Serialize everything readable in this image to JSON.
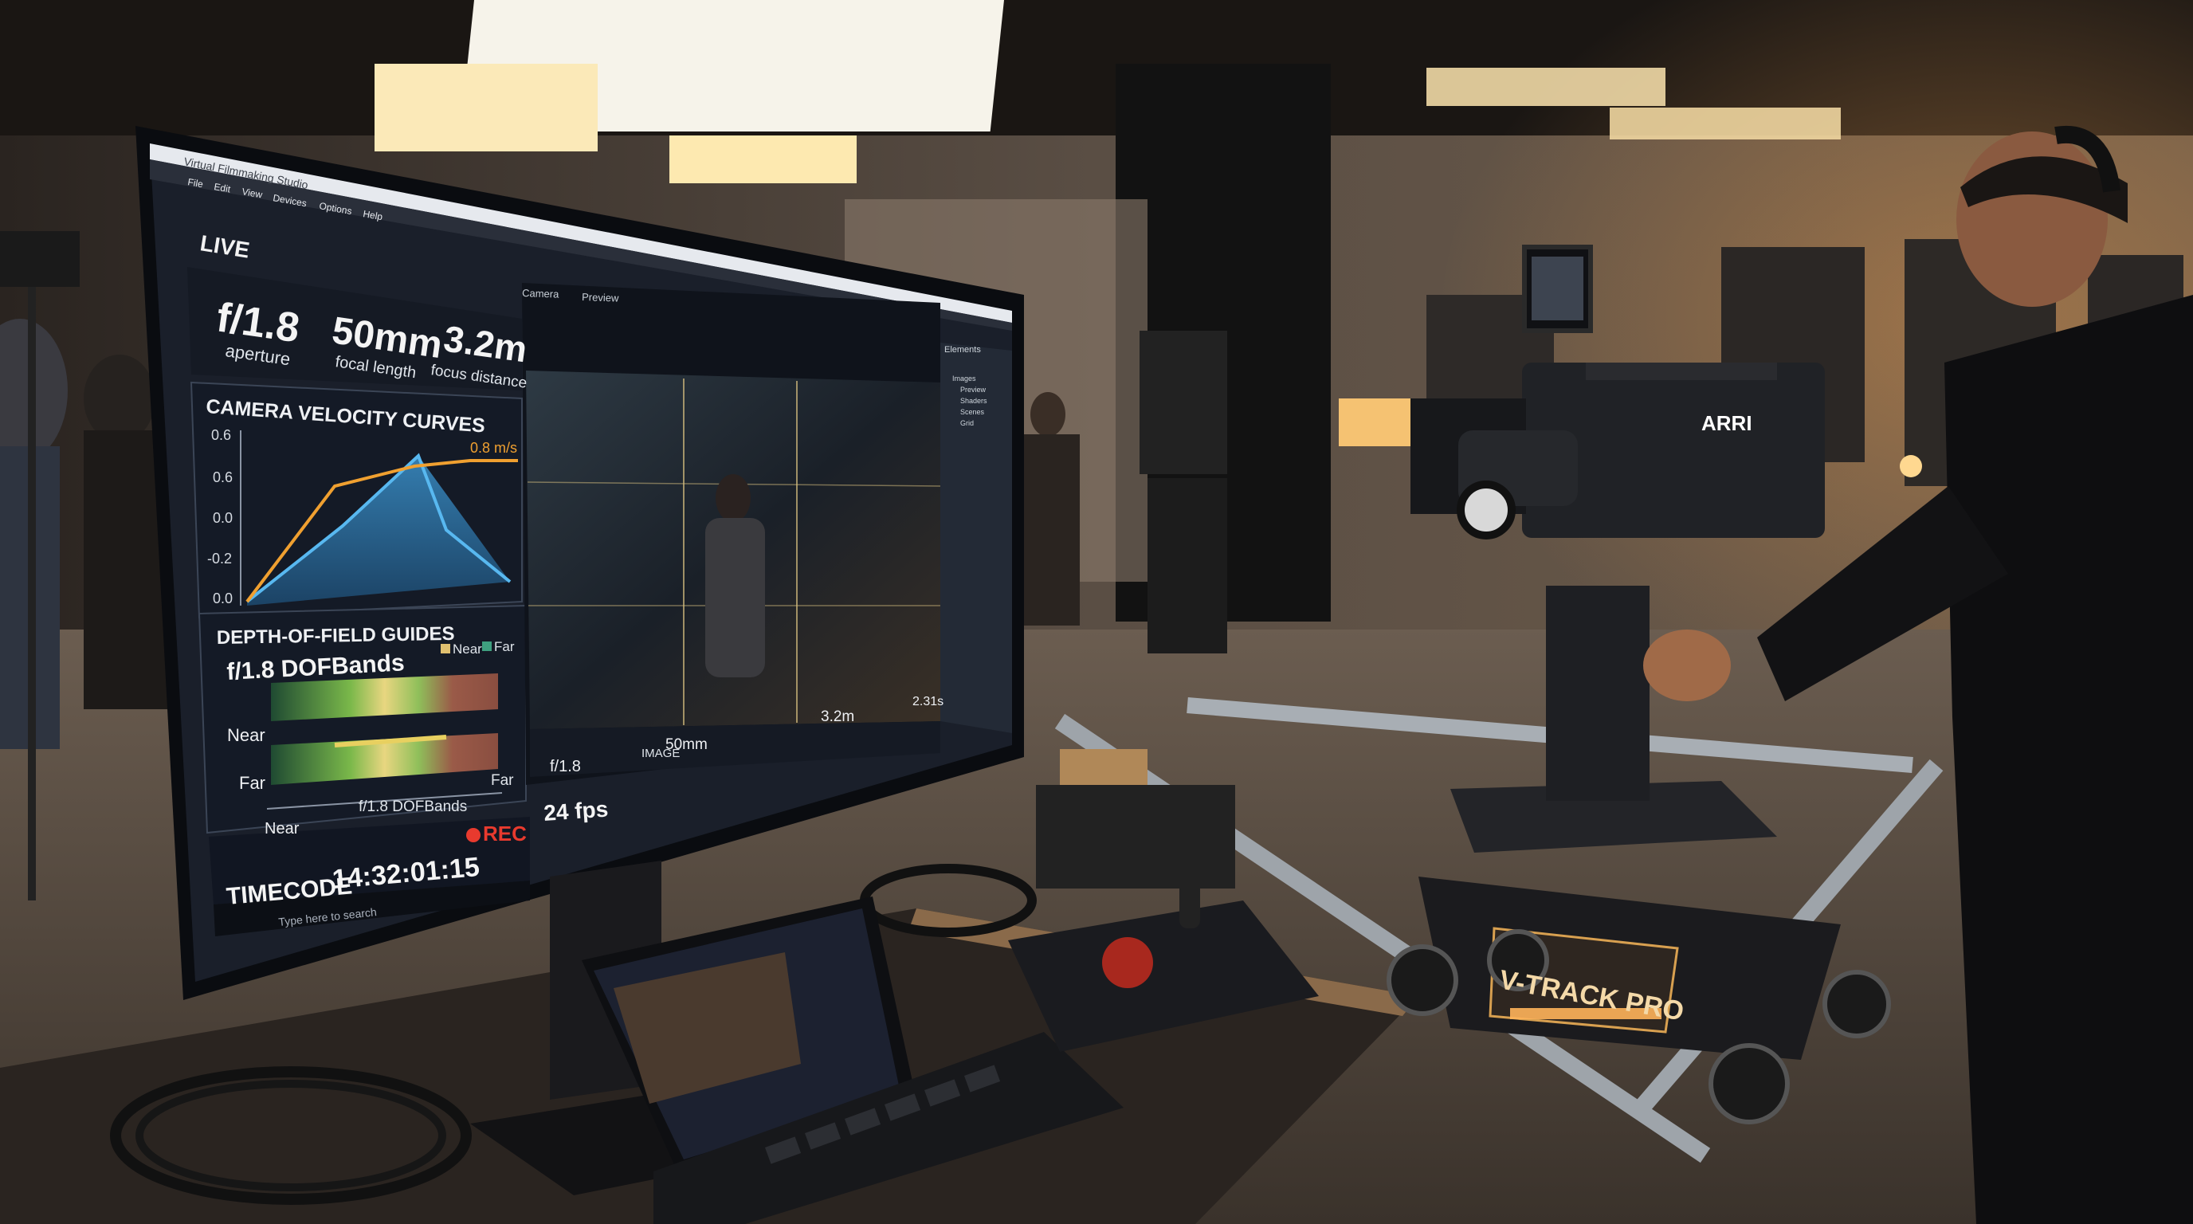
{
  "monitor": {
    "window_title": "Virtual Filmmaking Studio",
    "menu": [
      "File",
      "Edit",
      "View",
      "Devices",
      "Options",
      "Help"
    ],
    "live_label": "LIVE",
    "stats": [
      {
        "value": "f/1.8",
        "label": "aperture"
      },
      {
        "value": "50mm",
        "label": "focal length"
      },
      {
        "value": "3.2m",
        "label": "focus distance"
      }
    ],
    "velocity_panel": {
      "title": "CAMERA VELOCITY CURVES",
      "y_ticks": [
        "0.6",
        "0.6",
        "0.0",
        "-0.2",
        "0.0"
      ],
      "peak_label": "0.8 m/s"
    },
    "dof_panel": {
      "title": "DEPTH-OF-FIELD GUIDES",
      "legend_near": "Near",
      "legend_far": "Far",
      "band_title": "f/1.8 DOFBands",
      "row_near": "Near",
      "row_far": "Far",
      "axis_left": "Near",
      "axis_center": "f/1.8 DOFBands",
      "axis_right": "Far"
    },
    "timecode_label": "TIMECODE",
    "timecode_value": "14:32:01:15",
    "rec_label": "REC",
    "fps_label": "24 fps",
    "search_placeholder": "Type here to search",
    "viewer": {
      "tabs": [
        "Camera",
        "Preview"
      ],
      "bottom_f": "f/1.8",
      "bottom_focal": "50mm",
      "bottom_focus": "3.2m",
      "bottom_right": "2.31s",
      "image_label": "IMAGE"
    },
    "right_panel": {
      "title": "Elements",
      "items": [
        "Images",
        "Preview",
        "Shaders",
        "Scenes",
        "Grid"
      ]
    }
  },
  "camera_body_label": "ARRI",
  "dolly_label": "V-TRACK PRO",
  "colors": {
    "accent_orange": "#f0a030",
    "accent_blue": "#3ba8e0",
    "rec_red": "#e83a2e",
    "ui_bg": "#1c2230"
  }
}
